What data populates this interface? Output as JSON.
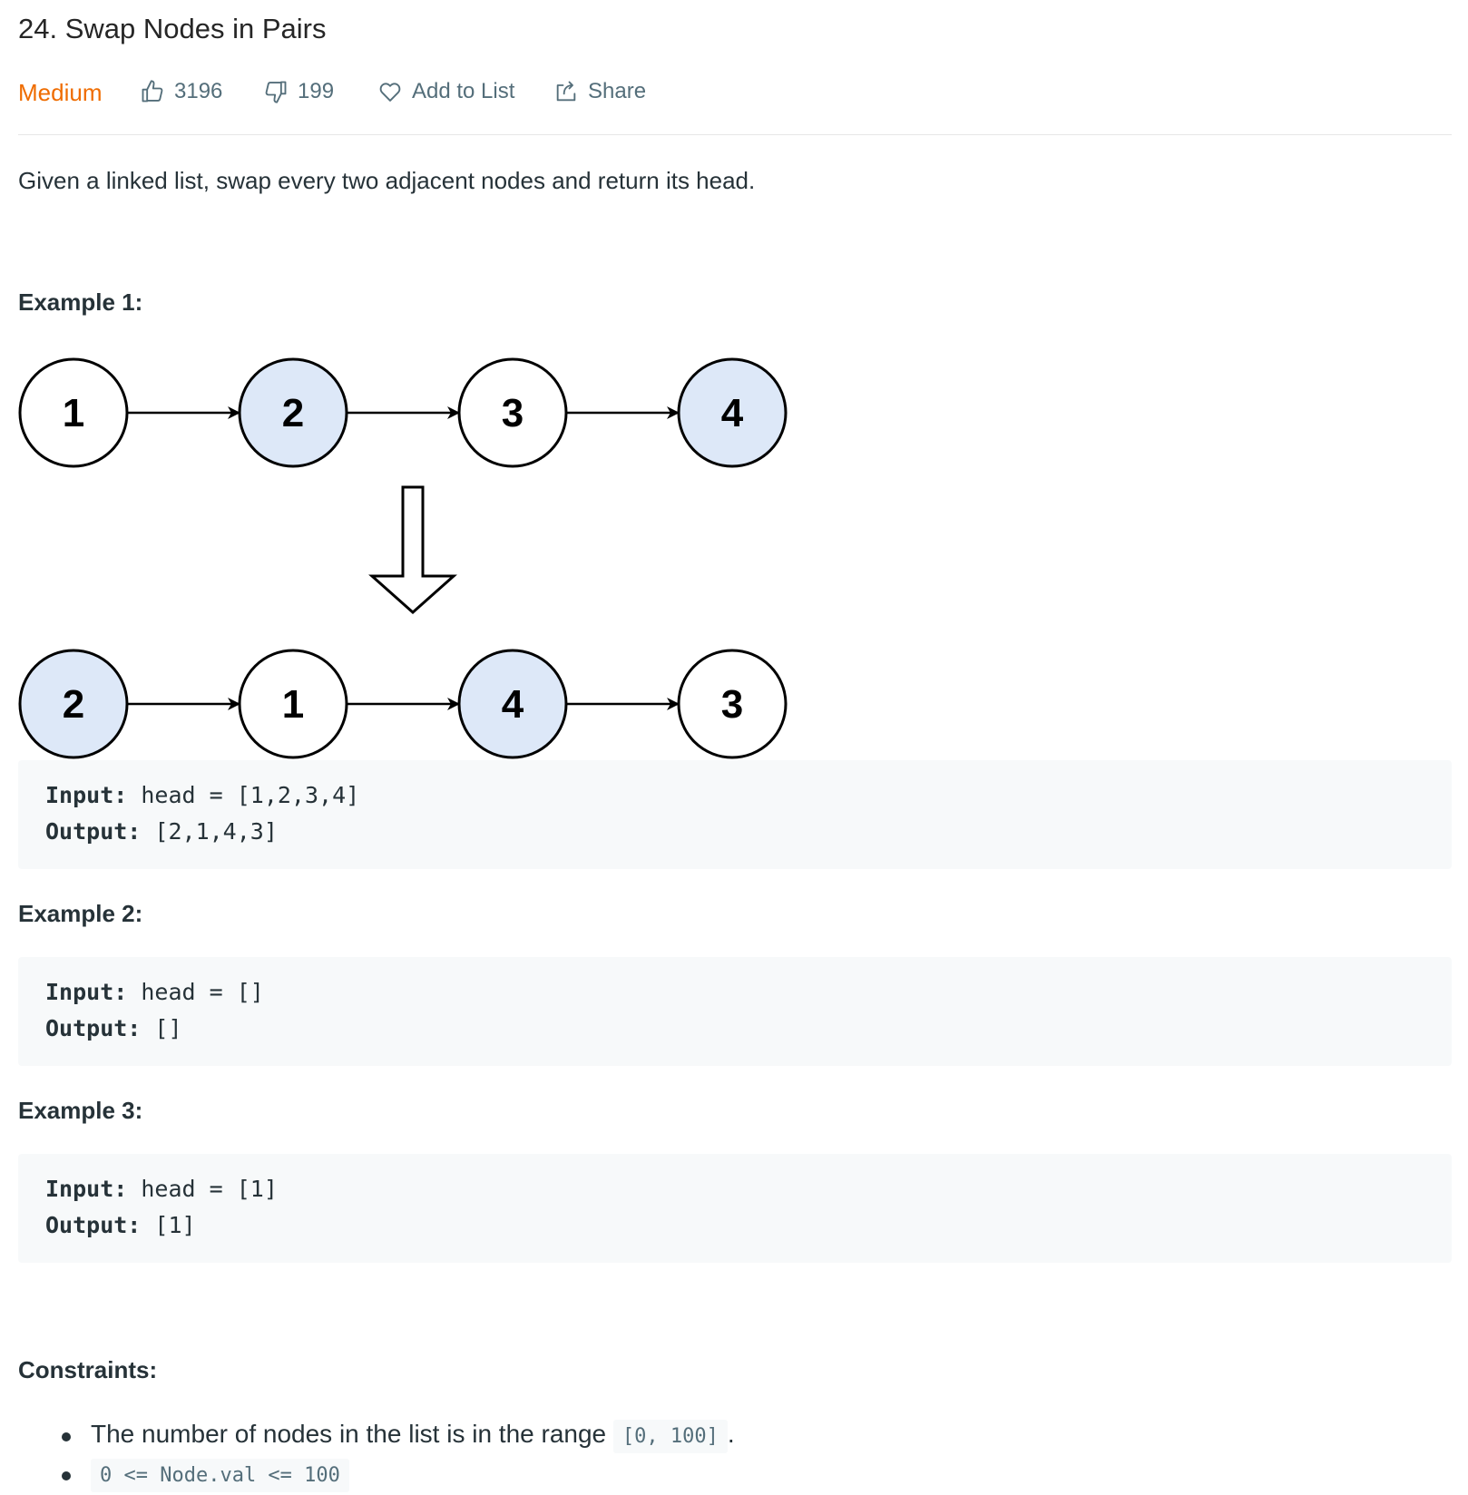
{
  "problem": {
    "title": "24. Swap Nodes in Pairs",
    "difficulty": "Medium",
    "likes": "3196",
    "dislikes": "199",
    "add_to_list_label": "Add to List",
    "share_label": "Share",
    "description": "Given a linked list, swap every two adjacent nodes and return its head."
  },
  "colors": {
    "difficulty": "#ef6c00",
    "highlight_node": "#dde8f8"
  },
  "examples": [
    {
      "heading": "Example 1:",
      "input_label": "Input:",
      "input_value": " head = [1,2,3,4]",
      "output_label": "Output:",
      "output_value": " [2,1,4,3]",
      "diagram": {
        "before": [
          "1",
          "2",
          "3",
          "4"
        ],
        "after": [
          "2",
          "1",
          "4",
          "3"
        ],
        "highlighted_before": [
          false,
          true,
          false,
          true
        ],
        "highlighted_after": [
          true,
          false,
          true,
          false
        ]
      }
    },
    {
      "heading": "Example 2:",
      "input_label": "Input:",
      "input_value": " head = []",
      "output_label": "Output:",
      "output_value": " []"
    },
    {
      "heading": "Example 3:",
      "input_label": "Input:",
      "input_value": " head = [1]",
      "output_label": "Output:",
      "output_value": " [1]"
    }
  ],
  "constraints": {
    "heading": "Constraints:",
    "item1_text": "The number of nodes in the list is in the range ",
    "item1_code": "[0, 100]",
    "item1_suffix": ".",
    "item2_code": "0 <= Node.val <= 100"
  }
}
